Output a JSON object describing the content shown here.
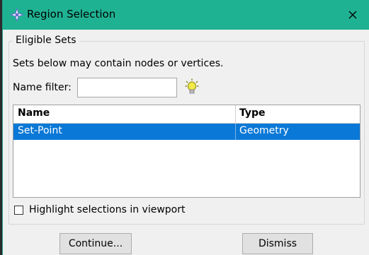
{
  "window": {
    "title": "Region Selection",
    "title_icon": "abaqus-cross-icon",
    "accent_color": "#1fb292"
  },
  "group": {
    "legend": "Eligible Sets",
    "description": "Sets below may contain nodes or vertices.",
    "filter": {
      "label": "Name filter:",
      "value": "",
      "placeholder": ""
    },
    "filter_hint_icon": "lightbulb-icon"
  },
  "table": {
    "columns": [
      "Name",
      "Type"
    ],
    "rows": [
      {
        "name": "Set-Point",
        "type": "Geometry",
        "selected": true
      }
    ],
    "selection_color": "#0a78d7"
  },
  "options": {
    "highlight_label": "Highlight selections in viewport",
    "highlight_checked": false
  },
  "buttons": {
    "continue": "Continue...",
    "dismiss": "Dismiss"
  }
}
